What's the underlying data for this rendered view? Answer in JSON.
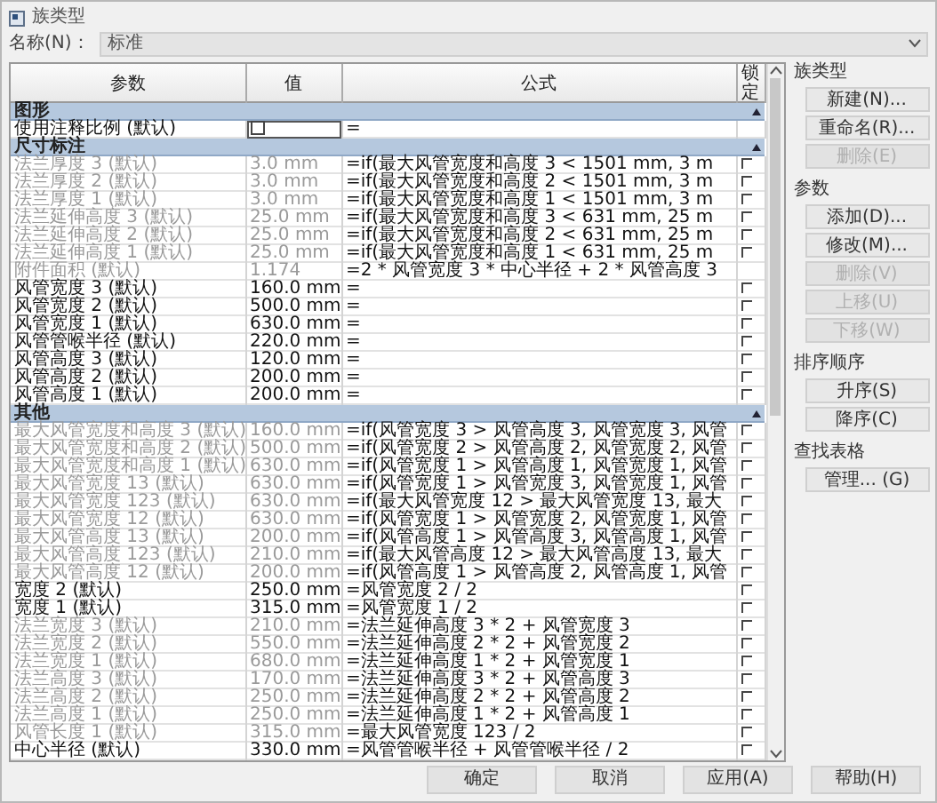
{
  "window": {
    "title": "族类型"
  },
  "name_field": {
    "label": "名称(N)：",
    "value": "标准"
  },
  "table": {
    "columns": [
      "参数",
      "值",
      "公式",
      "锁定"
    ],
    "groups": [
      {
        "title": "图形",
        "expanded": true,
        "rows": [
          {
            "parameter": "使用注释比例 (默认)",
            "kind": "checkbox",
            "checked": false,
            "formula": "=",
            "disabled": false
          }
        ]
      },
      {
        "title": "尺寸标注",
        "expanded": true,
        "rows": [
          {
            "parameter": "法兰厚度 3 (默认)",
            "kind": "text",
            "value": "3.0 mm",
            "formula": "=if(最大风管宽度和高度 3 < 1501 mm, 3 m",
            "locked": false,
            "disabled": true
          },
          {
            "parameter": "法兰厚度 2 (默认)",
            "kind": "text",
            "value": "3.0 mm",
            "formula": "=if(最大风管宽度和高度 2 < 1501 mm, 3 m",
            "locked": false,
            "disabled": true
          },
          {
            "parameter": "法兰厚度 1 (默认)",
            "kind": "text",
            "value": "3.0 mm",
            "formula": "=if(最大风管宽度和高度 1 < 1501 mm, 3 m",
            "locked": false,
            "disabled": true
          },
          {
            "parameter": "法兰延伸高度 3 (默认)",
            "kind": "text",
            "value": "25.0 mm",
            "formula": "=if(最大风管宽度和高度 3 < 631 mm, 25 m",
            "locked": false,
            "disabled": true
          },
          {
            "parameter": "法兰延伸高度 2 (默认)",
            "kind": "text",
            "value": "25.0 mm",
            "formula": "=if(最大风管宽度和高度 2 < 631 mm, 25 m",
            "locked": false,
            "disabled": true
          },
          {
            "parameter": "法兰延伸高度 1 (默认)",
            "kind": "text",
            "value": "25.0 mm",
            "formula": "=if(最大风管宽度和高度 1 < 631 mm, 25 m",
            "locked": false,
            "disabled": true
          },
          {
            "parameter": "附件面积 (默认)",
            "kind": "text",
            "value": "1.174",
            "formula": "=2 * 风管宽度 3 * 中心半径 + 2 * 风管高度 3",
            "disabled": true
          },
          {
            "parameter": "风管宽度 3 (默认)",
            "kind": "text",
            "value": "160.0 mm",
            "formula": "=",
            "locked": false,
            "disabled": false
          },
          {
            "parameter": "风管宽度 2 (默认)",
            "kind": "text",
            "value": "500.0 mm",
            "formula": "=",
            "locked": false,
            "disabled": false
          },
          {
            "parameter": "风管宽度 1 (默认)",
            "kind": "text",
            "value": "630.0 mm",
            "formula": "=",
            "locked": false,
            "disabled": false
          },
          {
            "parameter": "风管管喉半径 (默认)",
            "kind": "text",
            "value": "220.0 mm",
            "formula": "=",
            "locked": false,
            "disabled": false
          },
          {
            "parameter": "风管高度 3 (默认)",
            "kind": "text",
            "value": "120.0 mm",
            "formula": "=",
            "locked": false,
            "disabled": false
          },
          {
            "parameter": "风管高度 2 (默认)",
            "kind": "text",
            "value": "200.0 mm",
            "formula": "=",
            "locked": false,
            "disabled": false
          },
          {
            "parameter": "风管高度 1 (默认)",
            "kind": "text",
            "value": "200.0 mm",
            "formula": "=",
            "locked": false,
            "disabled": false
          }
        ]
      },
      {
        "title": "其他",
        "expanded": true,
        "rows": [
          {
            "parameter": "最大风管宽度和高度 3 (默认)",
            "kind": "text",
            "value": "160.0 mm",
            "formula": "=if(风管宽度 3 > 风管高度 3, 风管宽度 3, 风管",
            "locked": false,
            "disabled": true
          },
          {
            "parameter": "最大风管宽度和高度 2 (默认)",
            "kind": "text",
            "value": "500.0 mm",
            "formula": "=if(风管宽度 2 > 风管高度 2, 风管宽度 2, 风管",
            "locked": false,
            "disabled": true
          },
          {
            "parameter": "最大风管宽度和高度 1 (默认)",
            "kind": "text",
            "value": "630.0 mm",
            "formula": "=if(风管宽度 1 > 风管高度 1, 风管宽度 1, 风管",
            "locked": false,
            "disabled": true
          },
          {
            "parameter": "最大风管宽度 13 (默认)",
            "kind": "text",
            "value": "630.0 mm",
            "formula": "=if(风管宽度 1 > 风管宽度 3, 风管宽度 1, 风管",
            "locked": false,
            "disabled": true
          },
          {
            "parameter": "最大风管宽度 123 (默认)",
            "kind": "text",
            "value": "630.0 mm",
            "formula": "=if(最大风管宽度 12 > 最大风管宽度 13, 最大",
            "locked": false,
            "disabled": true
          },
          {
            "parameter": "最大风管宽度 12 (默认)",
            "kind": "text",
            "value": "630.0 mm",
            "formula": "=if(风管宽度 1 > 风管宽度 2, 风管宽度 1, 风管",
            "locked": false,
            "disabled": true
          },
          {
            "parameter": "最大风管高度 13 (默认)",
            "kind": "text",
            "value": "200.0 mm",
            "formula": "=if(风管高度 1 > 风管高度 3, 风管高度 1, 风管",
            "locked": false,
            "disabled": true
          },
          {
            "parameter": "最大风管高度 123 (默认)",
            "kind": "text",
            "value": "210.0 mm",
            "formula": "=if(最大风管高度 12 > 最大风管高度 13, 最大",
            "locked": false,
            "disabled": true
          },
          {
            "parameter": "最大风管高度 12 (默认)",
            "kind": "text",
            "value": "200.0 mm",
            "formula": "=if(风管高度 1 > 风管高度 2, 风管高度 1, 风管",
            "locked": false,
            "disabled": true
          },
          {
            "parameter": "宽度 2 (默认)",
            "kind": "text",
            "value": "250.0 mm",
            "formula": "=风管宽度 2 / 2",
            "locked": false,
            "disabled": false
          },
          {
            "parameter": "宽度 1 (默认)",
            "kind": "text",
            "value": "315.0 mm",
            "formula": "=风管宽度 1 / 2",
            "locked": false,
            "disabled": false
          },
          {
            "parameter": "法兰宽度 3 (默认)",
            "kind": "text",
            "value": "210.0 mm",
            "formula": "=法兰延伸高度 3 * 2 + 风管宽度 3",
            "locked": false,
            "disabled": true
          },
          {
            "parameter": "法兰宽度 2 (默认)",
            "kind": "text",
            "value": "550.0 mm",
            "formula": "=法兰延伸高度 2 * 2 + 风管宽度 2",
            "locked": false,
            "disabled": true
          },
          {
            "parameter": "法兰宽度 1 (默认)",
            "kind": "text",
            "value": "680.0 mm",
            "formula": "=法兰延伸高度 1 * 2 + 风管宽度 1",
            "locked": false,
            "disabled": true
          },
          {
            "parameter": "法兰高度 3 (默认)",
            "kind": "text",
            "value": "170.0 mm",
            "formula": "=法兰延伸高度 3 * 2 + 风管高度 3",
            "locked": false,
            "disabled": true
          },
          {
            "parameter": "法兰高度 2 (默认)",
            "kind": "text",
            "value": "250.0 mm",
            "formula": "=法兰延伸高度 2 * 2 + 风管高度 2",
            "locked": false,
            "disabled": true
          },
          {
            "parameter": "法兰高度 1 (默认)",
            "kind": "text",
            "value": "250.0 mm",
            "formula": "=法兰延伸高度 1 * 2 + 风管高度 1",
            "locked": false,
            "disabled": true
          },
          {
            "parameter": "风管长度 1 (默认)",
            "kind": "text",
            "value": "315.0 mm",
            "formula": "=最大风管宽度 123 / 2",
            "locked": false,
            "disabled": true
          },
          {
            "parameter": "中心半径 (默认)",
            "kind": "text",
            "value": "330.0 mm",
            "formula": "=风管管喉半径 + 风管管喉半径 / 2",
            "locked": false,
            "disabled": false
          }
        ]
      }
    ]
  },
  "side_panel": [
    {
      "title": "族类型",
      "buttons": [
        {
          "label": "新建(N)...",
          "disabled": false
        },
        {
          "label": "重命名(R)...",
          "disabled": false
        },
        {
          "label": "删除(E)",
          "disabled": true
        }
      ]
    },
    {
      "title": "参数",
      "buttons": [
        {
          "label": "添加(D)...",
          "disabled": false
        },
        {
          "label": "修改(M)...",
          "disabled": false
        },
        {
          "label": "删除(V)",
          "disabled": true
        },
        {
          "label": "上移(U)",
          "disabled": true
        },
        {
          "label": "下移(W)",
          "disabled": true
        }
      ]
    },
    {
      "title": "排序顺序",
      "buttons": [
        {
          "label": "升序(S)",
          "disabled": false
        },
        {
          "label": "降序(C)",
          "disabled": false
        }
      ]
    },
    {
      "title": "查找表格",
      "buttons": [
        {
          "label": "管理... (G)",
          "disabled": false
        }
      ]
    }
  ],
  "footer_buttons": [
    "确定",
    "取消",
    "应用(A)",
    "帮助(H)"
  ]
}
